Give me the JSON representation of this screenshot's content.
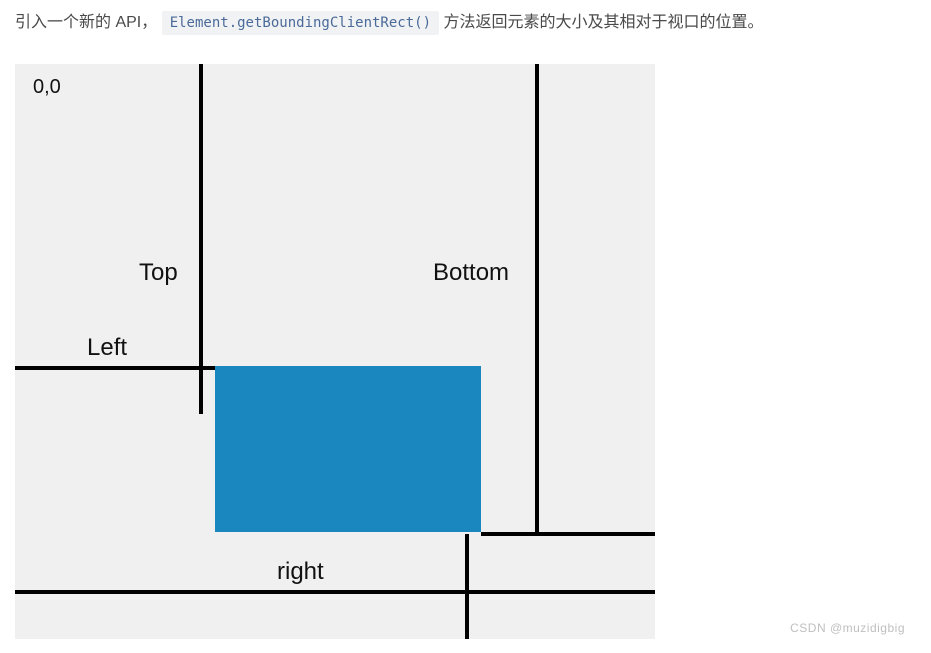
{
  "intro": {
    "prefix": "引入一个新的 API，",
    "code": "Element.getBoundingClientRect()",
    "suffix": "方法返回元素的大小及其相对于视口的位置。"
  },
  "diagram": {
    "origin": "0,0",
    "labels": {
      "top": "Top",
      "bottom": "Bottom",
      "left": "Left",
      "right": "right"
    }
  },
  "watermark": "CSDN @muzidigbig"
}
